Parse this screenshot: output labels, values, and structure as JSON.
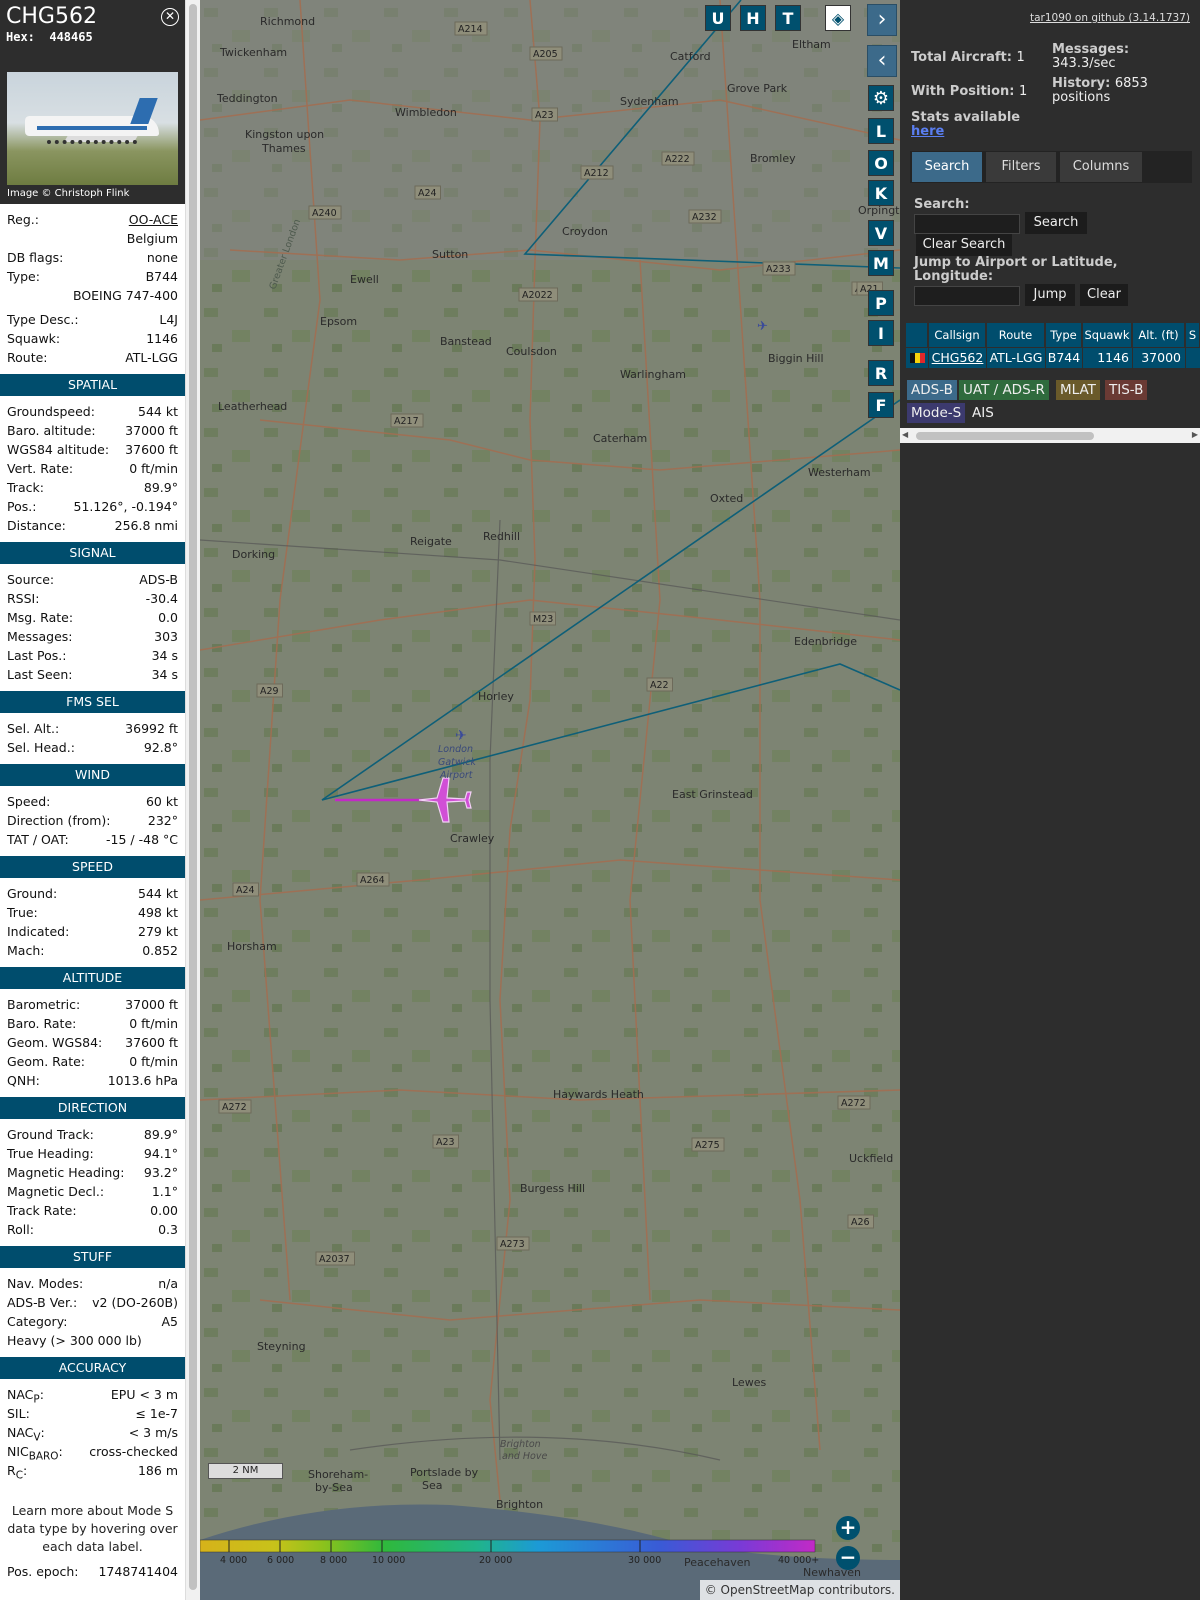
{
  "aircraft": {
    "callsign": "CHG562",
    "hex_label": "Hex:",
    "hex": "448465",
    "photo_credit": "Image © Christoph Flink",
    "registration": "OO-ACE",
    "country": "Belgium",
    "db_flags": "none",
    "type": "B744",
    "type_full": "BOEING 747-400",
    "type_desc": "L4J",
    "squawk": "1146",
    "route": "ATL-LGG"
  },
  "labels": {
    "reg": "Reg.:",
    "db_flags": "DB flags:",
    "type": "Type:",
    "type_desc": "Type Desc.:",
    "squawk": "Squawk:",
    "route": "Route:"
  },
  "sections": [
    {
      "title": "SPATIAL",
      "rows": [
        {
          "k": "Groundspeed:",
          "v": "544 kt"
        },
        {
          "k": "Baro. altitude:",
          "v": "37000 ft"
        },
        {
          "k": "WGS84 altitude:",
          "v": "37600 ft"
        },
        {
          "k": "Vert. Rate:",
          "v": "0 ft/min"
        },
        {
          "k": "Track:",
          "v": "89.9°"
        },
        {
          "k": "Pos.:",
          "v": "51.126°, -0.194°"
        },
        {
          "k": "Distance:",
          "v": "256.8 nmi"
        }
      ]
    },
    {
      "title": "SIGNAL",
      "rows": [
        {
          "k": "Source:",
          "v": "ADS-B"
        },
        {
          "k": "RSSI:",
          "v": "-30.4"
        },
        {
          "k": "Msg. Rate:",
          "v": "0.0"
        },
        {
          "k": "Messages:",
          "v": "303"
        },
        {
          "k": "Last Pos.:",
          "v": "34 s"
        },
        {
          "k": "Last Seen:",
          "v": "34 s"
        }
      ]
    },
    {
      "title": "FMS SEL",
      "rows": [
        {
          "k": "Sel. Alt.:",
          "v": "36992 ft"
        },
        {
          "k": "Sel. Head.:",
          "v": "92.8°"
        }
      ]
    },
    {
      "title": "WIND",
      "rows": [
        {
          "k": "Speed:",
          "v": "60 kt"
        },
        {
          "k": "Direction (from):",
          "v": "232°"
        },
        {
          "k": "TAT / OAT:",
          "v": "-15 / -48 °C"
        }
      ]
    },
    {
      "title": "SPEED",
      "rows": [
        {
          "k": "Ground:",
          "v": "544 kt"
        },
        {
          "k": "True:",
          "v": "498 kt"
        },
        {
          "k": "Indicated:",
          "v": "279 kt"
        },
        {
          "k": "Mach:",
          "v": "0.852"
        }
      ]
    },
    {
      "title": "ALTITUDE",
      "rows": [
        {
          "k": "Barometric:",
          "v": "37000 ft"
        },
        {
          "k": "Baro. Rate:",
          "v": "0 ft/min"
        },
        {
          "k": "Geom. WGS84:",
          "v": "37600 ft"
        },
        {
          "k": "Geom. Rate:",
          "v": "0 ft/min"
        },
        {
          "k": "QNH:",
          "v": "1013.6 hPa"
        }
      ]
    },
    {
      "title": "DIRECTION",
      "rows": [
        {
          "k": "Ground Track:",
          "v": "89.9°"
        },
        {
          "k": "True Heading:",
          "v": "94.1°"
        },
        {
          "k": "Magnetic Heading:",
          "v": "93.2°"
        },
        {
          "k": "Magnetic Decl.:",
          "v": "1.1°"
        },
        {
          "k": "Track Rate:",
          "v": "0.00"
        },
        {
          "k": "Roll:",
          "v": "0.3"
        }
      ]
    },
    {
      "title": "STUFF",
      "rows": [
        {
          "k": "Nav. Modes:",
          "v": "n/a"
        },
        {
          "k": "ADS-B Ver.:",
          "v": "v2 (DO-260B)"
        },
        {
          "k": "Category:",
          "v": "A5"
        },
        {
          "k": "Heavy (> 300 000 lb)",
          "v": ""
        }
      ]
    }
  ],
  "accuracy": {
    "title": "ACCURACY",
    "nacp_label": "NAC",
    "nacp_sub": "P",
    "nacp_value": "EPU < 3 m",
    "sil_label": "SIL:",
    "sil_value": "≤ 1e-7",
    "nacv_label": "NAC",
    "nacv_sub": "V",
    "nacv_value": "< 3 m/s",
    "nicbaro_label": "NIC",
    "nicbaro_sub": "BARO",
    "nicbaro_value": "cross-checked",
    "rc_label": "R",
    "rc_sub": "C",
    "rc_value": "186 m"
  },
  "learn_more": "Learn more about Mode S data type by hovering over each data label.",
  "pos_epoch_label": "Pos. epoch:",
  "pos_epoch": "1748741404",
  "map": {
    "buttons_top": [
      "U",
      "H",
      "T"
    ],
    "buttons_side": [
      "L",
      "O",
      "K",
      "V",
      "M",
      "P",
      "I",
      "R",
      "F"
    ],
    "towns": [
      {
        "name": "Richmond"
      },
      {
        "name": "Twickenham"
      },
      {
        "name": "Teddington"
      },
      {
        "name": "Kingston upon"
      },
      {
        "name": "Thames"
      },
      {
        "name": "Wimbledon"
      },
      {
        "name": "Sydenham"
      },
      {
        "name": "Catford"
      },
      {
        "name": "Eltham"
      },
      {
        "name": "Grove Park"
      },
      {
        "name": "Bromley"
      },
      {
        "name": "Croydon"
      },
      {
        "name": "Sutton"
      },
      {
        "name": "Ewell"
      },
      {
        "name": "Epsom"
      },
      {
        "name": "Banstead"
      },
      {
        "name": "Coulsdon"
      },
      {
        "name": "Warlingham"
      },
      {
        "name": "Biggin Hill"
      },
      {
        "name": "Leatherhead"
      },
      {
        "name": "Caterham"
      },
      {
        "name": "Westerham"
      },
      {
        "name": "Oxted"
      },
      {
        "name": "Redhill"
      },
      {
        "name": "Reigate"
      },
      {
        "name": "Dorking"
      },
      {
        "name": "Edenbridge"
      },
      {
        "name": "Horley"
      },
      {
        "name": "Crawley"
      },
      {
        "name": "East Grinstead"
      },
      {
        "name": "Horsham"
      },
      {
        "name": "Haywards Heath"
      },
      {
        "name": "Burgess Hill"
      },
      {
        "name": "Uckfield"
      },
      {
        "name": "Steyning"
      },
      {
        "name": "Lewes"
      },
      {
        "name": "Brighton"
      },
      {
        "name": "Portslade by"
      },
      {
        "name": "Sea"
      },
      {
        "name": "Shoreham-"
      },
      {
        "name": "by-Sea"
      },
      {
        "name": "Peacehaven"
      },
      {
        "name": "Newhaven"
      },
      {
        "name": "Orpington"
      },
      {
        "name": "Brighton"
      },
      {
        "name": "and Hove"
      },
      {
        "name": "London"
      },
      {
        "name": "Gatwick"
      },
      {
        "name": "Airport"
      },
      {
        "name": "Greater London"
      }
    ],
    "roads": [
      "A214",
      "A205",
      "A23",
      "A222",
      "A212",
      "A24",
      "A240",
      "A232",
      "A2022",
      "A233",
      "A217",
      "A21",
      "M23",
      "A22",
      "A29",
      "A264",
      "A24",
      "A272",
      "A23",
      "A275",
      "A272",
      "A26",
      "A273",
      "A2037",
      "A21"
    ],
    "altitude_scale": [
      "4 000",
      "6 000",
      "8 000",
      "10 000",
      "20 000",
      "30 000",
      "40 000+"
    ],
    "scale_label": "2 NM",
    "attribution_prefix": "© ",
    "attribution_link": "OpenStreetMap",
    "attribution_suffix": " contributors.",
    "zoom_in": "+",
    "zoom_out": "−"
  },
  "right": {
    "github": "tar1090 on github (3.14.1737)",
    "total_aircraft_label": "Total Aircraft:",
    "total_aircraft": "1",
    "with_position_label": "With Position:",
    "with_position": "1",
    "messages_label": "Messages:",
    "messages": "343.3/sec",
    "history_label": "History:",
    "history": "6853",
    "history_unit": "positions",
    "stats_label": "Stats available",
    "stats_link": "here",
    "tabs": [
      "Search",
      "Filters",
      "Columns"
    ],
    "search_label": "Search:",
    "search_button": "Search",
    "clear_search_button": "Clear Search",
    "jump_label_1": "Jump to Airport or Latitude,",
    "jump_label_2": "Longitude:",
    "jump_button": "Jump",
    "clear_button": "Clear",
    "table_headers": [
      "Callsign",
      "Route",
      "Type",
      "Squawk",
      "Alt. (ft)",
      "S"
    ],
    "table_row": {
      "callsign": "CHG562",
      "route": "ATL-LGG",
      "type": "B744",
      "squawk": "1146",
      "alt": "37000"
    },
    "sources": [
      {
        "label": "ADS-B",
        "color": "#3c6a8a"
      },
      {
        "label": "UAT / ADS-R",
        "color": "#2f6b3d"
      },
      {
        "label": "MLAT",
        "color": "#6a5a2a"
      },
      {
        "label": "TIS-B",
        "color": "#6a3a34"
      },
      {
        "label": "Mode-S",
        "color": "#3c3a6e"
      },
      {
        "label": "AIS",
        "color": ""
      }
    ]
  }
}
